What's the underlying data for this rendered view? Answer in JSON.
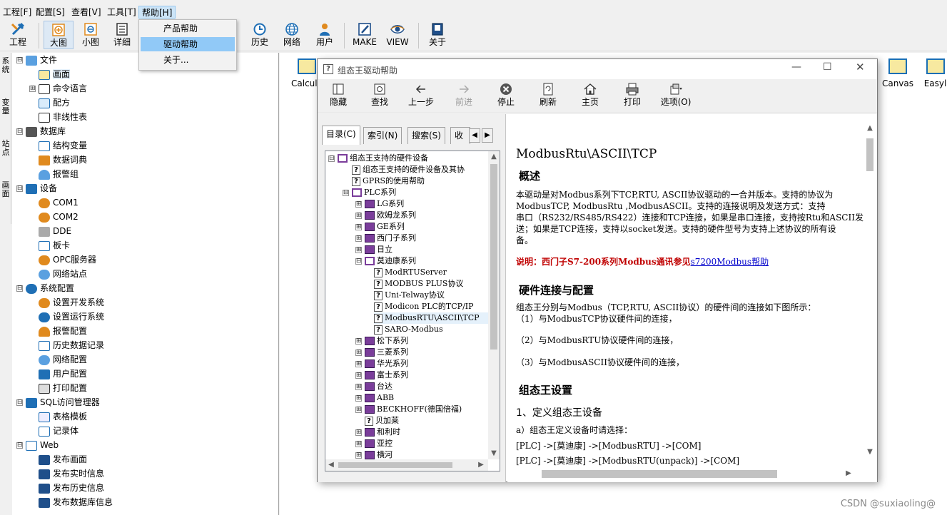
{
  "menu": [
    {
      "label": "工程[F]"
    },
    {
      "label": "配置[S]"
    },
    {
      "label": "查看[V]"
    },
    {
      "label": "工具[T]"
    },
    {
      "label": "帮助[H]"
    }
  ],
  "help_menu_items": [
    "产品帮助",
    "驱动帮助",
    "关于..."
  ],
  "toolbar": {
    "project": "工程",
    "large_icon": "大图",
    "small_icon": "小图",
    "detail": "详细",
    "history": "历史",
    "network": "网络",
    "user": "用户",
    "make": "MAKE",
    "view": "VIEW",
    "about": "关于"
  },
  "vtabs": [
    "系统",
    "变量",
    "站点",
    "画面"
  ],
  "tree": [
    {
      "label": "文件",
      "exp": "⊟"
    },
    {
      "label": "画面"
    },
    {
      "label": "命令语言",
      "exp": "⊞"
    },
    {
      "label": "配方"
    },
    {
      "label": "非线性表"
    },
    {
      "label": "数据库",
      "exp": "⊟"
    },
    {
      "label": "结构变量"
    },
    {
      "label": "数据词典"
    },
    {
      "label": "报警组"
    },
    {
      "label": "设备",
      "exp": "⊟"
    },
    {
      "label": "COM1"
    },
    {
      "label": "COM2"
    },
    {
      "label": "DDE"
    },
    {
      "label": "板卡"
    },
    {
      "label": "OPC服务器"
    },
    {
      "label": "网络站点"
    },
    {
      "label": "系统配置",
      "exp": "⊟"
    },
    {
      "label": "设置开发系统"
    },
    {
      "label": "设置运行系统"
    },
    {
      "label": "报警配置"
    },
    {
      "label": "历史数据记录"
    },
    {
      "label": "网络配置"
    },
    {
      "label": "用户配置"
    },
    {
      "label": "打印配置"
    },
    {
      "label": "SQL访问管理器",
      "exp": "⊟"
    },
    {
      "label": "表格模板"
    },
    {
      "label": "记录体"
    },
    {
      "label": "Web",
      "exp": "⊟"
    },
    {
      "label": "发布画面"
    },
    {
      "label": "发布实时信息"
    },
    {
      "label": "发布历史信息"
    },
    {
      "label": "发布数据库信息"
    }
  ],
  "workspace_items": [
    "Calcula",
    "Canvas",
    "Easyl"
  ],
  "help": {
    "title": "组态王驱动帮助",
    "toolbar": [
      "隐藏",
      "查找",
      "上一步",
      "前进",
      "停止",
      "刷新",
      "主页",
      "打印",
      "选项(O)"
    ],
    "tabs": [
      "目录(C)",
      "索引(N)",
      "搜索(S)",
      "收"
    ],
    "toc": [
      {
        "label": "组态王支持的硬件设备",
        "exp": "⊟",
        "icon": "book-open"
      },
      {
        "label": "组态王支持的硬件设备及其协",
        "icon": "page"
      },
      {
        "label": "GPRS的使用帮助",
        "icon": "page"
      },
      {
        "label": "PLC系列",
        "exp": "⊟",
        "icon": "book-open"
      },
      {
        "label": "LG系列",
        "exp": "⊞",
        "icon": "book"
      },
      {
        "label": "欧姆龙系列",
        "exp": "⊞",
        "icon": "book"
      },
      {
        "label": "GE系列",
        "exp": "⊞",
        "icon": "book"
      },
      {
        "label": "西门子系列",
        "exp": "⊞",
        "icon": "book"
      },
      {
        "label": "日立",
        "exp": "⊞",
        "icon": "book"
      },
      {
        "label": "莫迪康系列",
        "exp": "⊟",
        "icon": "book-open"
      },
      {
        "label": "ModRTUServer",
        "icon": "page"
      },
      {
        "label": "MODBUS PLUS协议",
        "icon": "page"
      },
      {
        "label": "Uni-Telway协议",
        "icon": "page"
      },
      {
        "label": "Modicon PLC的TCP/IP",
        "icon": "page"
      },
      {
        "label": "ModbusRTU\\ASCII\\TCP",
        "icon": "page"
      },
      {
        "label": "SARO-Modbus",
        "icon": "page"
      },
      {
        "label": "松下系列",
        "exp": "⊞",
        "icon": "book"
      },
      {
        "label": "三菱系列",
        "exp": "⊞",
        "icon": "book"
      },
      {
        "label": "华光系列",
        "exp": "⊞",
        "icon": "book"
      },
      {
        "label": "富士系列",
        "exp": "⊞",
        "icon": "book"
      },
      {
        "label": "台达",
        "exp": "⊞",
        "icon": "book"
      },
      {
        "label": "ABB",
        "exp": "⊞",
        "icon": "book"
      },
      {
        "label": "BECKHOFF(德国倍福)",
        "exp": "⊞",
        "icon": "book"
      },
      {
        "label": "贝加莱",
        "icon": "page"
      },
      {
        "label": "和利时",
        "exp": "⊞",
        "icon": "book"
      },
      {
        "label": "亚控",
        "exp": "⊞",
        "icon": "book"
      },
      {
        "label": "横河",
        "exp": "⊞",
        "icon": "book"
      }
    ],
    "content": {
      "title": "ModbusRtu\\ASCII\\TCP",
      "overview_heading": "概述",
      "overview_lines": [
        "本驱动是对Modbus系列下TCP,RTU, ASCII协议驱动的一合并版本。支持的协议为",
        "ModbusTCP,      ModbusRtu ,ModbusASCII。支持的连接说明及发送方式：支持",
        "串口（RS232/RS485/RS422）连接和TCP连接，如果是串口连接，支持按Rtu和ASCII发",
        "送；如果是TCP连接，支持以socket发送。支持的硬件型号为支持上述协议的所有设",
        "备。"
      ],
      "note_label": "说明：西门子S7-200系列Modbus通讯参见",
      "note_link": "s7200Modbus帮助",
      "hw_heading": "硬件连接与配置",
      "hw_intro": "组态王分别与Modbus（TCP,RTU, ASCII协议）的硬件间的连接如下图所示：",
      "hw_items": [
        "（1）与ModbusTCP协议硬件间的连接，",
        "（2）与ModbusRTU协议硬件间的连接，",
        "（3）与ModbusASCII协议硬件间的连接，"
      ],
      "kv_heading": "组态王设置",
      "step1": "1、定义组态王设备",
      "step_a": "a）组态王定义设备时请选择：",
      "paths": [
        "[PLC] ->[莫迪康] ->[ModbusRTU] ->[COM]",
        "[PLC] ->[莫迪康] ->[ModbusRTU(unpack)] ->[COM]"
      ]
    }
  },
  "watermark": "CSDN @suxiaoling@"
}
